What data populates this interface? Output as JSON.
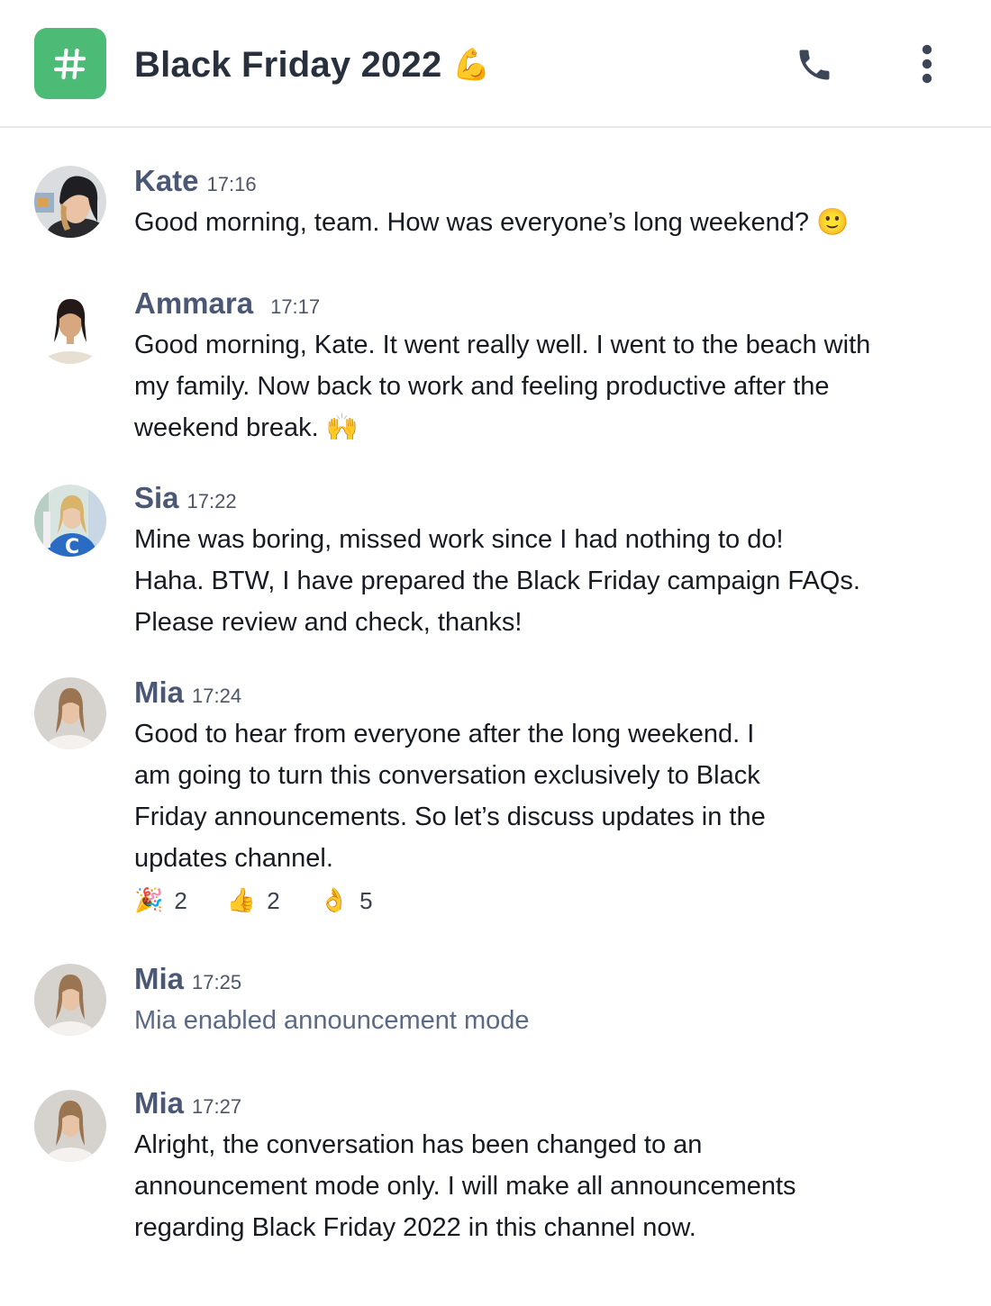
{
  "header": {
    "badge_symbol": "#",
    "title": "Black Friday 2022",
    "title_emoji": "💪",
    "phone_icon": "phone-icon",
    "more_icon": "more-vertical-icon",
    "accent_color": "#4cbb76"
  },
  "messages": [
    {
      "author": "Kate",
      "time": "17:16",
      "lines": [
        "Good morning, team. How was everyone’s long weekend? 🙂"
      ]
    },
    {
      "author": "Ammara",
      "time": "17:17",
      "lines": [
        "Good morning, Kate. It went really well. I went to the beach with",
        "my family. Now back to work and feeling productive after the",
        "weekend break. 🙌"
      ]
    },
    {
      "author": "Sia",
      "time": "17:22",
      "lines": [
        "Mine was boring, missed work since I had nothing to do!",
        "Haha. BTW, I have prepared the Black Friday campaign FAQs.",
        "Please review and check, thanks!"
      ]
    },
    {
      "author": "Mia",
      "time": "17:24",
      "lines": [
        "Good to hear from everyone after the long weekend. I",
        "am going to turn this conversation exclusively to Black",
        "Friday announcements. So let’s discuss updates in the",
        "updates channel."
      ],
      "reactions": [
        {
          "emoji": "🎉",
          "count": "2"
        },
        {
          "emoji": "👍",
          "count": "2"
        },
        {
          "emoji": "👌",
          "count": "5"
        }
      ]
    },
    {
      "author": "Mia",
      "time": "17:25",
      "system_text": "Mia enabled announcement mode"
    },
    {
      "author": "Mia",
      "time": "17:27",
      "lines": [
        "Alright, the conversation has been changed to an",
        "announcement mode only. I will make all announcements",
        "regarding Black Friday 2022 in this channel now."
      ]
    }
  ]
}
